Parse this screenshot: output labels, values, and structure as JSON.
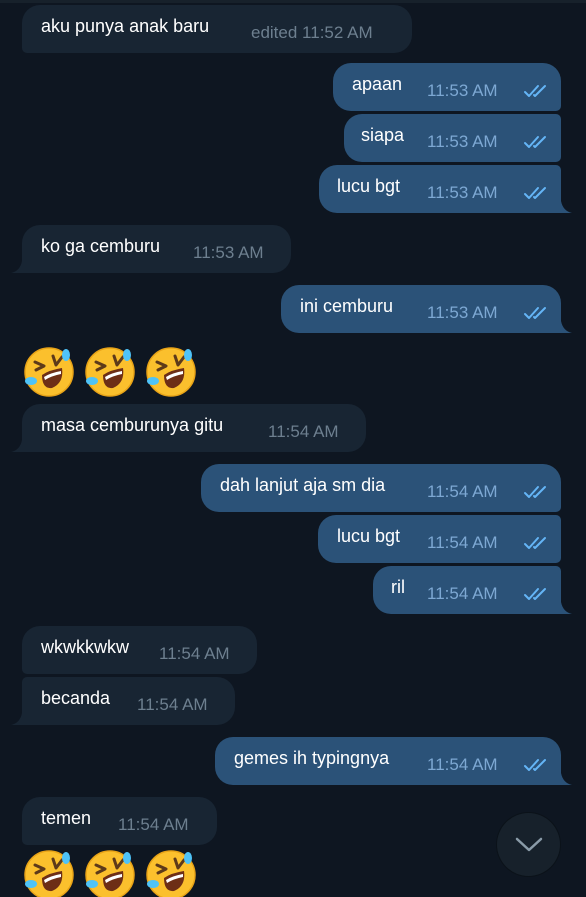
{
  "messages": [
    {
      "text": "aku punya anak baru",
      "time": "edited 11:52 AM",
      "direction": "in"
    },
    {
      "text": "apaan",
      "time": "11:53 AM",
      "direction": "out",
      "read": true
    },
    {
      "text": "siapa",
      "time": "11:53 AM",
      "direction": "out",
      "read": true
    },
    {
      "text": "lucu bgt",
      "time": "11:53 AM",
      "direction": "out",
      "read": true
    },
    {
      "text": "ko ga cemburu",
      "time": "11:53 AM",
      "direction": "in"
    },
    {
      "text": "ini cemburu",
      "time": "11:53 AM",
      "direction": "out",
      "read": true
    },
    {
      "text": "masa cemburunya gitu",
      "time": "11:54 AM",
      "direction": "in"
    },
    {
      "text": "dah lanjut aja sm dia",
      "time": "11:54 AM",
      "direction": "out",
      "read": true
    },
    {
      "text": "lucu bgt",
      "time": "11:54 AM",
      "direction": "out",
      "read": true
    },
    {
      "text": "ril",
      "time": "11:54 AM",
      "direction": "out",
      "read": true
    },
    {
      "text": "wkwkkwkw",
      "time": "11:54 AM",
      "direction": "in"
    },
    {
      "text": "becanda",
      "time": "11:54 AM",
      "direction": "in"
    },
    {
      "text": "gemes ih typingnya",
      "time": "11:54 AM",
      "direction": "out",
      "read": true
    },
    {
      "text": "temen",
      "time": "11:54 AM",
      "direction": "in"
    }
  ],
  "emoji_messages": [
    {
      "emoji": "rolling-on-the-floor-laughing",
      "count": 3,
      "direction": "in"
    },
    {
      "emoji": "rolling-on-the-floor-laughing",
      "count": 3,
      "direction": "in"
    }
  ],
  "scroll_button": {
    "icon": "chevron-down-icon"
  },
  "colors": {
    "background": "#0e1621",
    "incoming_bubble": "#182533",
    "outgoing_bubble": "#2b5278",
    "incoming_time": "#6d7f8f",
    "outgoing_time": "#7da8d3",
    "read_ticks": "#64b5f6"
  }
}
